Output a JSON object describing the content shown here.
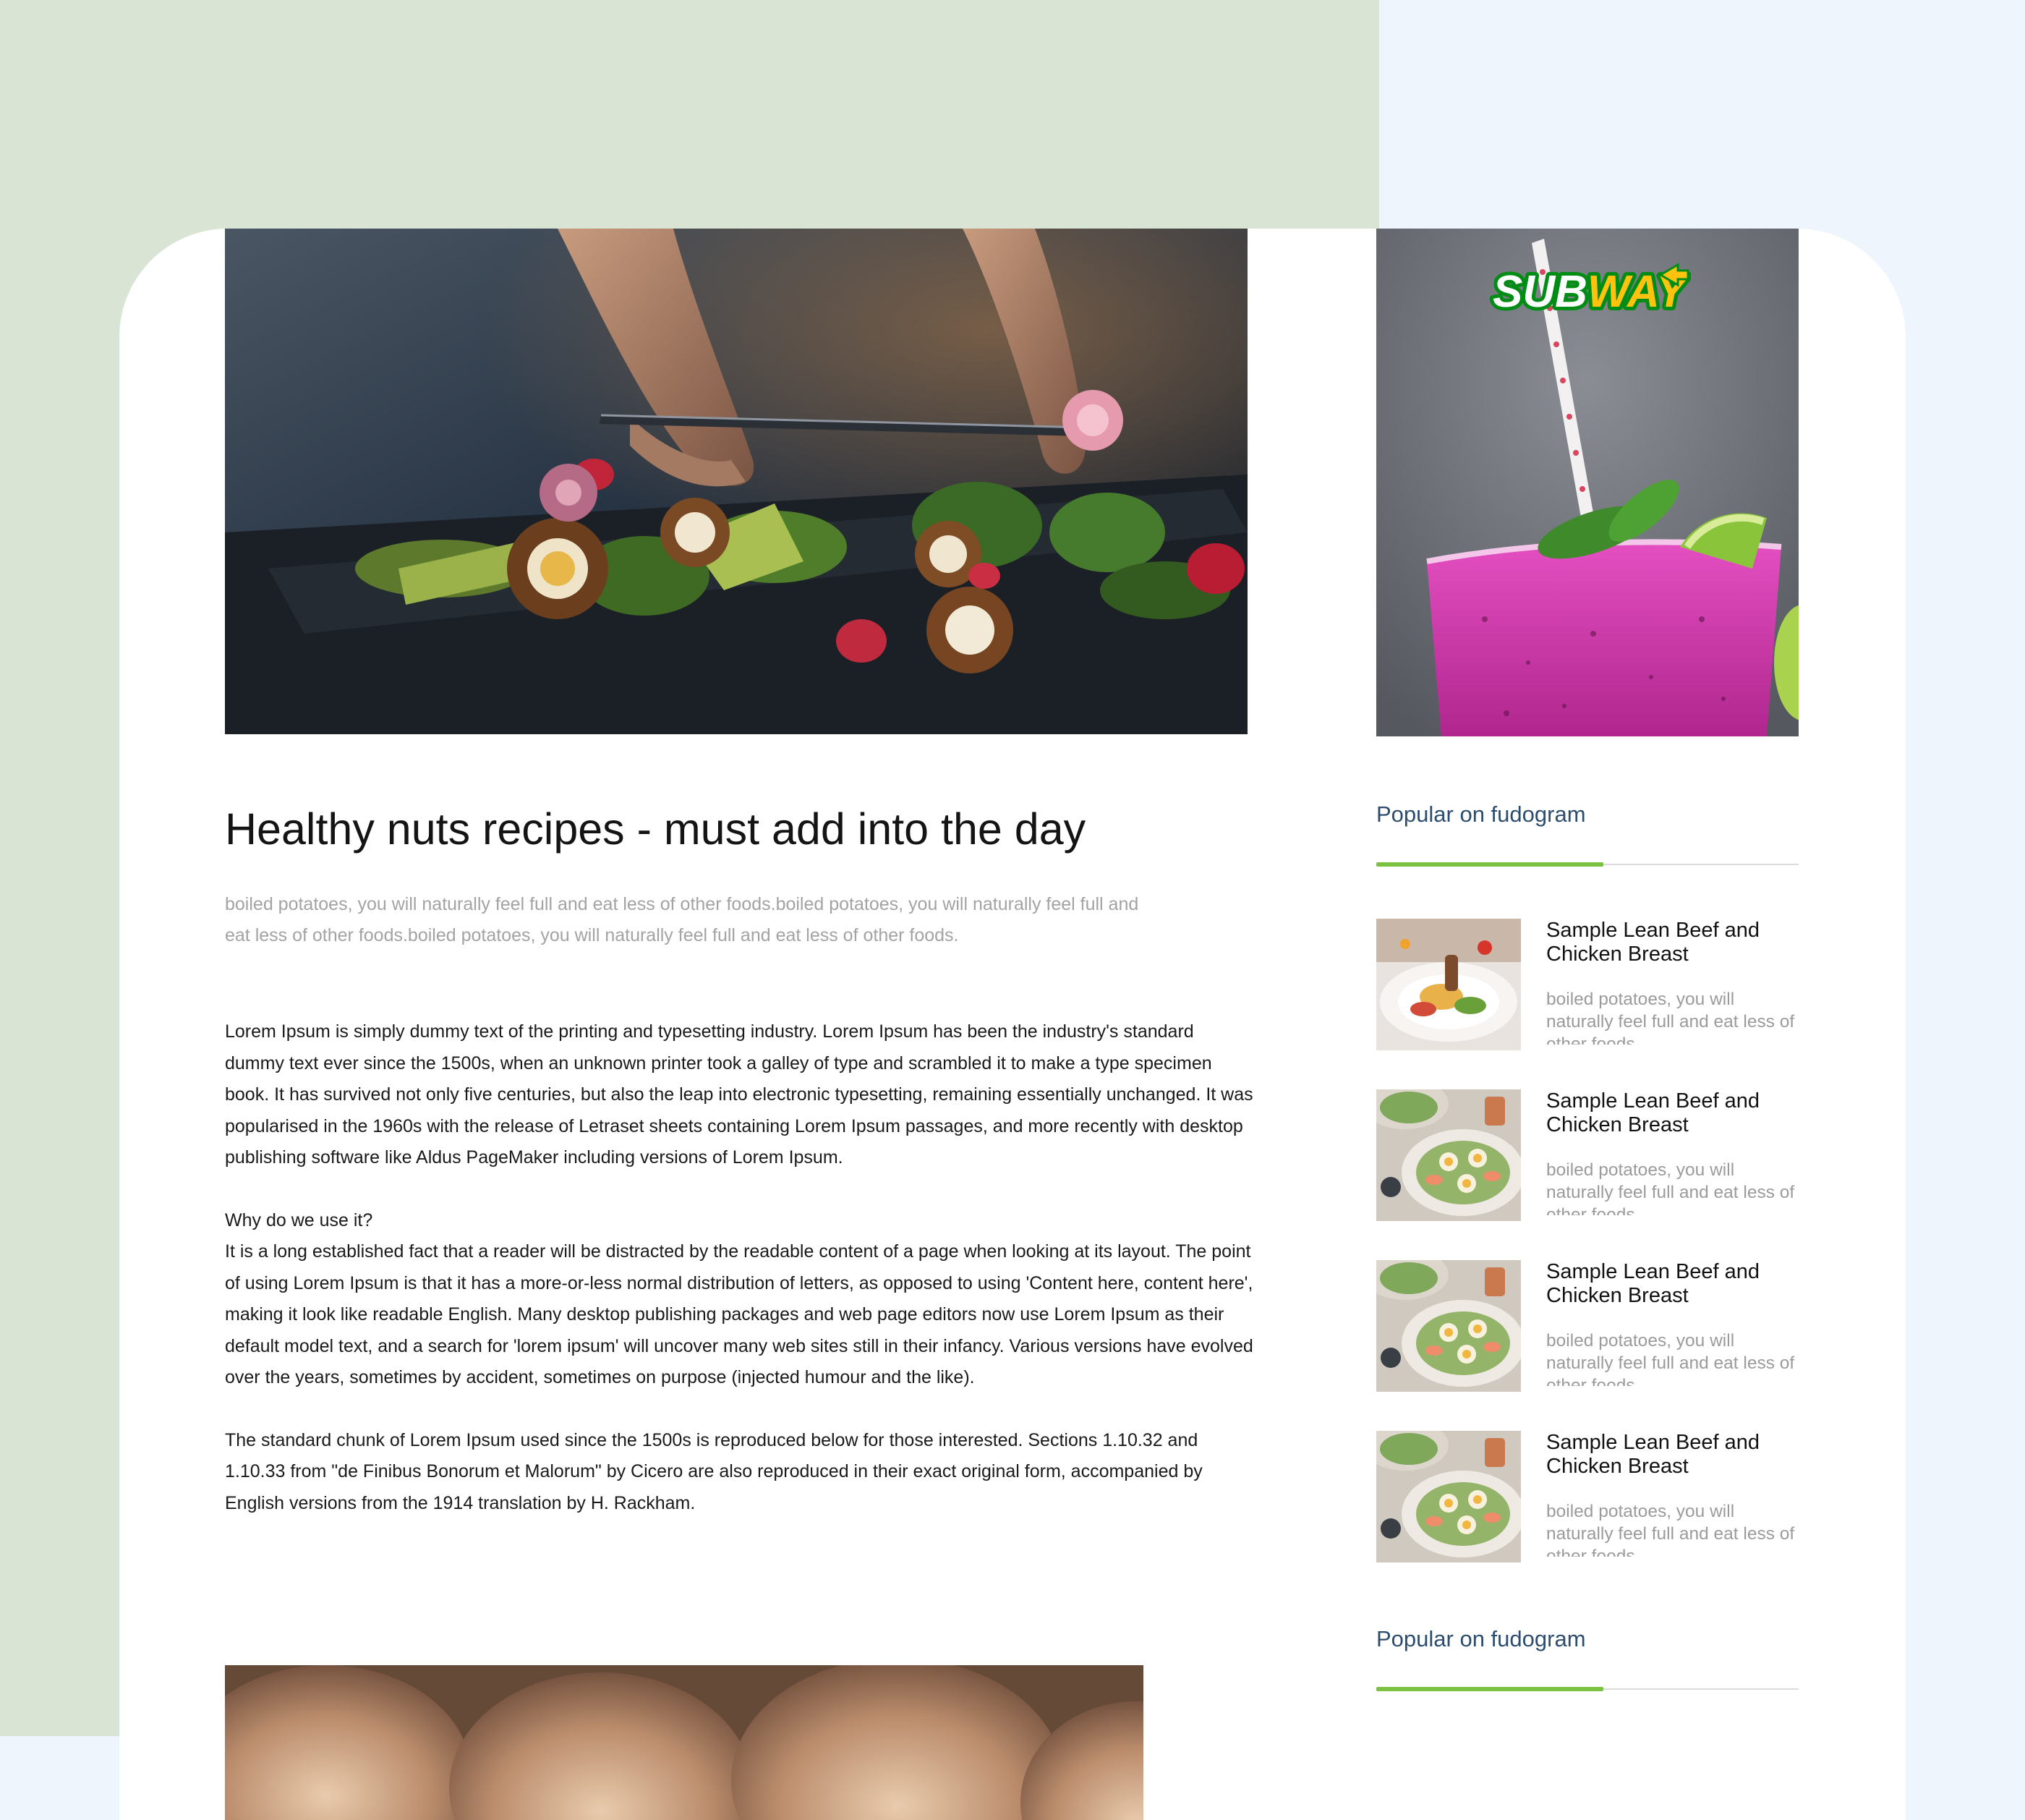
{
  "article": {
    "hero_image": "plated-food-tweezers-photo",
    "title": "Healthy nuts recipes - must add into the day",
    "lead": "boiled potatoes, you will naturally feel full and eat less of other foods.boiled potatoes, you will naturally feel full and eat less of other foods.boiled potatoes, you will naturally feel full and eat less of other foods.",
    "paragraphs": [
      "Lorem Ipsum is simply dummy text of the printing and typesetting industry. Lorem Ipsum has been the industry's standard dummy text ever since the 1500s, when an unknown printer took a galley of type and scrambled it to make a type specimen book. It has survived not only five centuries, but also the leap into electronic typesetting, remaining essentially unchanged. It was popularised in the 1960s with the release of Letraset sheets containing Lorem Ipsum passages, and more recently with desktop publishing software like Aldus PageMaker including versions of Lorem Ipsum.",
      "Why do we use it?",
      "It is a long established fact that a reader will be distracted by the readable content of a page when looking at its layout. The point of using Lorem Ipsum is that it has a more-or-less normal distribution of letters, as opposed to using 'Content here, content here', making it look like readable English. Many desktop publishing packages and web page editors now use Lorem Ipsum as their default model text, and a search for 'lorem ipsum' will uncover many web sites still in their infancy. Various versions have evolved over the years, sometimes by accident, sometimes on purpose (injected humour and the like).",
      "The standard chunk of Lorem Ipsum used since the 1500s is reproduced below for those interested. Sections 1.10.32 and 1.10.33 from \"de Finibus Bonorum et Malorum\" by Cicero are also reproduced in their exact original form, accompanied by English versions from the 1914 translation by H. Rackham."
    ],
    "bottom_image": "bread-rolls-photo"
  },
  "sidebar": {
    "ad": {
      "brand": "SUBWAY",
      "brand_part1": "SUB",
      "brand_part2": "WAY",
      "image": "pink-smoothie-photo",
      "colors": {
        "brand_white": "#ffffff",
        "brand_yellow": "#ffc20e",
        "brand_green": "#008c15"
      }
    },
    "popular_title": "Popular on fudogram",
    "popular_title_2": "Popular on fudogram",
    "items": [
      {
        "title": "Sample Lean Beef and Chicken Breast",
        "desc": "boiled potatoes, you will naturally feel full and eat less of other foods.",
        "thumb": "plated-salad-photo"
      },
      {
        "title": "Sample Lean Beef and Chicken Breast",
        "desc": "boiled potatoes, you will naturally feel full and eat less of other foods.",
        "thumb": "shrimp-egg-salad-photo"
      },
      {
        "title": "Sample Lean Beef and Chicken Breast",
        "desc": "boiled potatoes, you will naturally feel full and eat less of other foods.",
        "thumb": "shrimp-egg-salad-photo"
      },
      {
        "title": "Sample Lean Beef and Chicken Breast",
        "desc": "boiled potatoes, you will naturally feel full and eat less of other foods.",
        "thumb": "shrimp-egg-salad-photo"
      }
    ]
  },
  "colors": {
    "accent_green": "#7bc243",
    "section_title": "#2d4d6e",
    "muted_text": "#a3a3a3",
    "bg_left": "#d9e4d5",
    "bg_right": "#eef5fd"
  }
}
